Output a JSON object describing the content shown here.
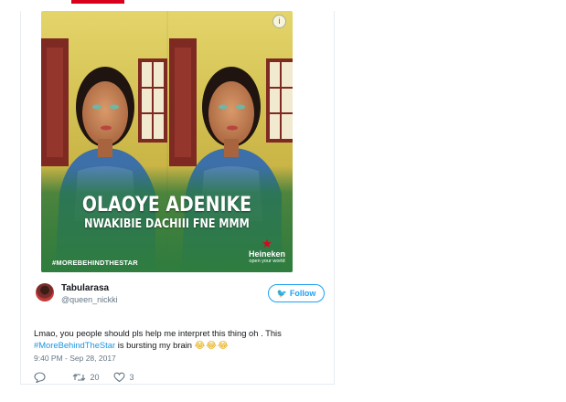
{
  "image_overlay": {
    "name": "OLAOYE ADENIKE",
    "subtitle": "NWAKIBIE DACHIII FNE MMM",
    "hashtag": "#MOREBEHINDTHESTAR",
    "brand_name": "Heineken",
    "brand_tagline": "open your world"
  },
  "tweet": {
    "display_name": "Tabularasa",
    "handle": "@queen_nickki",
    "follow_label": "Follow",
    "text_before": "Lmao, you people should pls help me interpret this thing oh . This",
    "hashtag": "#MoreBehindTheStar",
    "text_after": " is bursting my brain ",
    "emojis": "😂😂😂",
    "timestamp": "9:40 PM - Sep 28, 2017",
    "retweet_count": "20",
    "like_count": "3"
  },
  "icons": {
    "reply": "reply-icon",
    "retweet": "retweet-icon",
    "like": "heart-icon",
    "twitter": "twitter-bird-icon"
  },
  "colors": {
    "accent": "#1da1f2",
    "hashtag": "#1b95e0",
    "brand_star": "#e3001b",
    "background_green": "#3f8a4a",
    "wall_yellow": "#d9c84a"
  }
}
